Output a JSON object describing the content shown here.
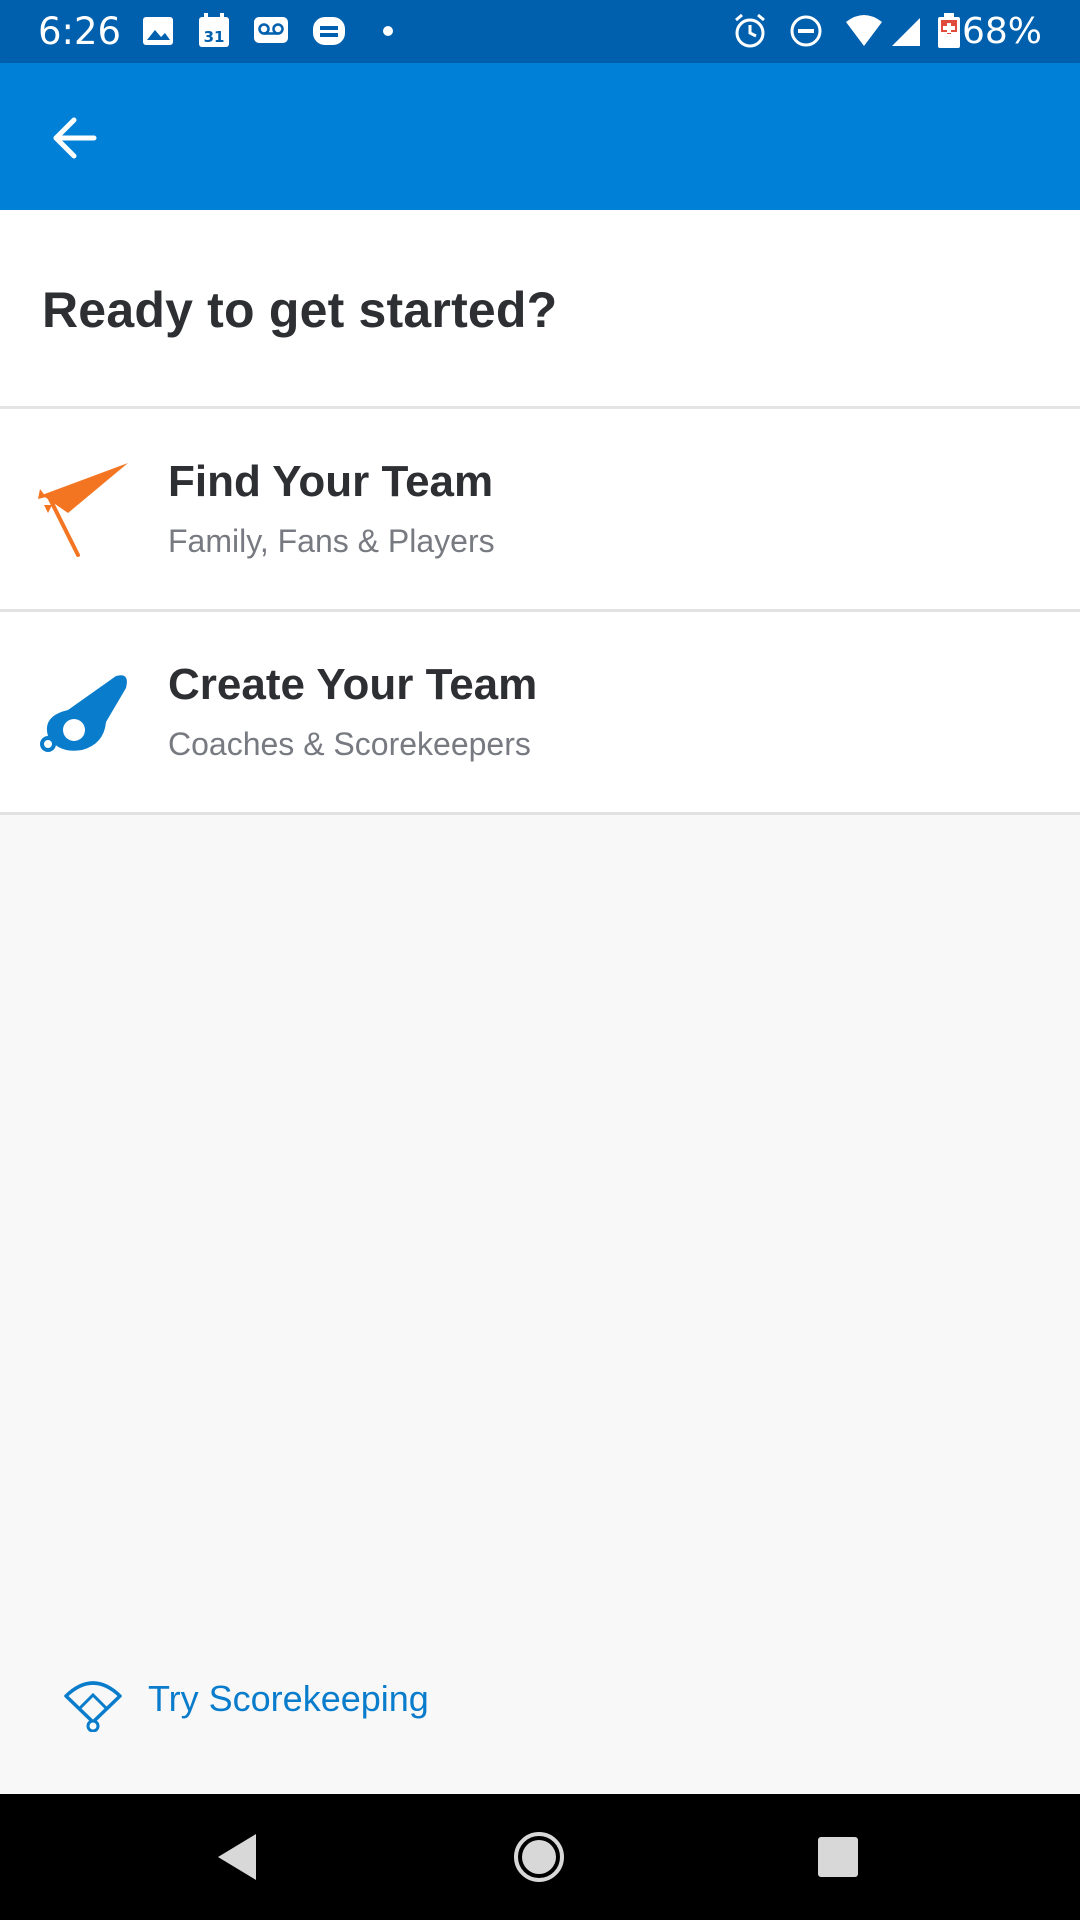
{
  "status_bar": {
    "time": "6:26",
    "battery_percent": "68%",
    "icons": [
      "image-icon",
      "calendar-icon",
      "voicemail-icon",
      "printer-icon",
      "dot-icon",
      "alarm-icon",
      "do-not-disturb-icon",
      "wifi-icon",
      "cellular-signal-icon",
      "battery-icon"
    ],
    "calendar_day": "31"
  },
  "colors": {
    "status_bar_bg": "#0060ad",
    "app_bar_bg": "#0080d6",
    "accent_orange": "#f47521",
    "accent_blue": "#0a7ccc",
    "page_bg": "#f8f8f8"
  },
  "header": {
    "title": "Ready to get started?"
  },
  "options": [
    {
      "title": "Find Your Team",
      "subtitle": "Family, Fans & Players",
      "icon": "pennant-icon"
    },
    {
      "title": "Create Your Team",
      "subtitle": "Coaches & Scorekeepers",
      "icon": "whistle-icon"
    }
  ],
  "scorekeeping": {
    "label": "Try Scorekeeping",
    "icon": "baseball-diamond-icon"
  },
  "nav_bar": {
    "buttons": [
      "back-triangle-icon",
      "home-circle-icon",
      "recents-square-icon"
    ]
  }
}
